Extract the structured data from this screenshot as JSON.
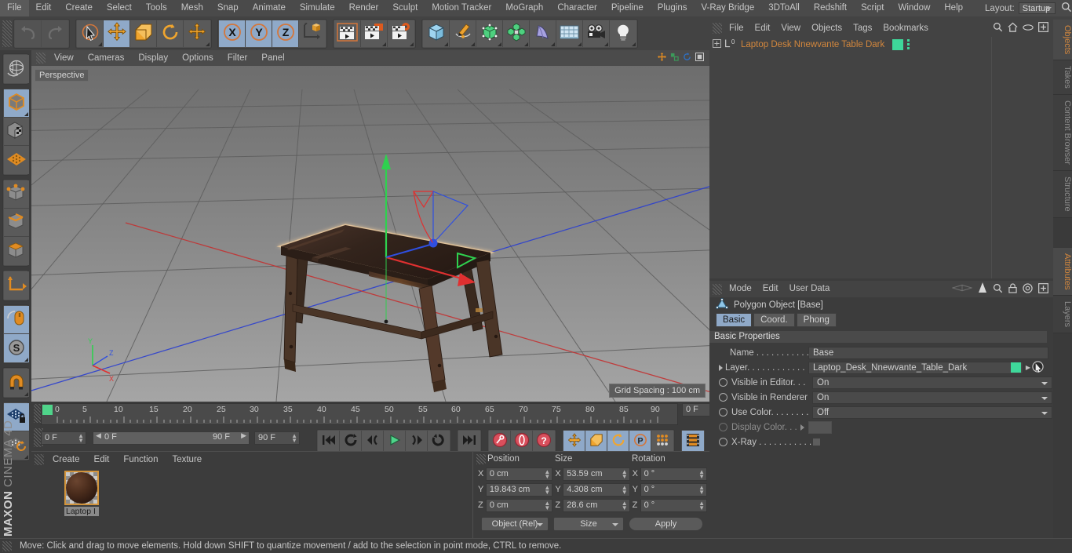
{
  "app": {
    "title": "MAXON CINEMA 4D",
    "brand_bold": "MAXON",
    "brand_light": "CINEMA 4D"
  },
  "menubar": {
    "items": [
      "File",
      "Edit",
      "Create",
      "Select",
      "Tools",
      "Mesh",
      "Snap",
      "Animate",
      "Simulate",
      "Render",
      "Sculpt",
      "Motion Tracker",
      "MoGraph",
      "Character",
      "Pipeline",
      "Plugins",
      "V-Ray Bridge",
      "3DToAll",
      "Redshift",
      "Script",
      "Window",
      "Help"
    ],
    "layout_label": "Layout:",
    "layout_value": "Startup",
    "search_icon": "magnifier-icon"
  },
  "toolbar": {
    "groups": [
      {
        "name": "undo-redo",
        "buttons": [
          {
            "icon": "undo-icon",
            "label": "Undo",
            "active": false,
            "disabled": true
          },
          {
            "icon": "redo-icon",
            "label": "Redo",
            "active": false,
            "disabled": true
          }
        ]
      },
      {
        "name": "transform-tools",
        "buttons": [
          {
            "icon": "select-cursor-icon",
            "label": "Live Selection",
            "active": false,
            "disabled": false
          },
          {
            "icon": "move-icon",
            "label": "Move",
            "active": true,
            "disabled": false
          },
          {
            "icon": "scale-icon",
            "label": "Scale",
            "active": false,
            "disabled": false
          },
          {
            "icon": "rotate-icon",
            "label": "Rotate",
            "active": false,
            "disabled": false
          },
          {
            "icon": "move-alt-icon",
            "label": "Move Tool Variant",
            "active": false,
            "disabled": false
          }
        ]
      },
      {
        "name": "axis-locks",
        "buttons": [
          {
            "icon": "x-axis-icon",
            "label": "X",
            "active": true,
            "disabled": false
          },
          {
            "icon": "y-axis-icon",
            "label": "Y",
            "active": true,
            "disabled": false
          },
          {
            "icon": "z-axis-icon",
            "label": "Z",
            "active": true,
            "disabled": false
          },
          {
            "icon": "world-object-coord-icon",
            "label": "World/Object",
            "active": false,
            "disabled": false
          }
        ]
      },
      {
        "name": "render-tools",
        "buttons": [
          {
            "icon": "render-view-icon",
            "label": "Render View",
            "active": false,
            "disabled": false
          },
          {
            "icon": "render-region-icon",
            "label": "Render to Picture Viewer",
            "active": false,
            "disabled": false
          },
          {
            "icon": "render-settings-icon",
            "label": "Edit Render Settings",
            "active": false,
            "disabled": false
          }
        ]
      },
      {
        "name": "create-objects",
        "buttons": [
          {
            "icon": "cube-icon",
            "label": "Add Cube Object",
            "active": false,
            "disabled": false
          },
          {
            "icon": "pen-spline-icon",
            "label": "Add Spline",
            "active": false,
            "disabled": false
          },
          {
            "icon": "nurbs-icon",
            "label": "Add HyperNURBS",
            "active": false,
            "disabled": false
          },
          {
            "icon": "array-icon",
            "label": "Add Array Object",
            "active": false,
            "disabled": false
          },
          {
            "icon": "bend-deformer-icon",
            "label": "Add Bend Object",
            "active": false,
            "disabled": false
          },
          {
            "icon": "floor-environment-icon",
            "label": "Add Floor Object",
            "active": false,
            "disabled": false
          },
          {
            "icon": "camera-icon",
            "label": "Add Camera",
            "active": false,
            "disabled": false
          },
          {
            "icon": "light-icon",
            "label": "Add Light",
            "active": false,
            "disabled": false
          }
        ]
      }
    ]
  },
  "left_palette": {
    "groups": [
      {
        "name": "modeling-axis",
        "buttons": [
          {
            "icon": "rotate-world-icon",
            "label": "Make Editable / Axis",
            "active": false
          }
        ]
      },
      {
        "name": "mode-objects",
        "buttons": [
          {
            "icon": "model-mode-icon",
            "label": "Model Mode",
            "active": true
          },
          {
            "icon": "texture-mode-icon",
            "label": "Texture Mode",
            "active": false
          },
          {
            "icon": "workplane-mode-icon",
            "label": "Workplane Mode",
            "active": false
          }
        ]
      },
      {
        "name": "component-modes",
        "buttons": [
          {
            "icon": "points-mode-icon",
            "label": "Points Mode",
            "active": false
          },
          {
            "icon": "edges-mode-icon",
            "label": "Edges Mode",
            "active": false
          },
          {
            "icon": "polygons-mode-icon",
            "label": "Polygons Mode",
            "active": false
          }
        ]
      },
      {
        "name": "axis-tools",
        "buttons": [
          {
            "icon": "enable-axis-icon",
            "label": "Enable Axis Modification",
            "active": false
          }
        ]
      },
      {
        "name": "snap-tools",
        "buttons": [
          {
            "icon": "mouse-viewport-icon",
            "label": "Viewport Solo",
            "active": true
          },
          {
            "icon": "snap-s-icon",
            "label": "Enable Snap",
            "active": true
          }
        ]
      },
      {
        "name": "magnet",
        "buttons": [
          {
            "icon": "magnet-icon",
            "label": "Enable Quantizing",
            "active": false
          }
        ]
      },
      {
        "name": "workplane",
        "buttons": [
          {
            "icon": "lock-workplane-icon",
            "label": "Lock Workplane",
            "active": true
          },
          {
            "icon": "planar-workplane-icon",
            "label": "Planar Workplane",
            "active": false
          }
        ]
      }
    ]
  },
  "viewport": {
    "menu": [
      "View",
      "Cameras",
      "Display",
      "Options",
      "Filter",
      "Panel"
    ],
    "label": "Perspective",
    "grid_spacing": "Grid Spacing : 100 cm",
    "axis_gizmo": {
      "x": "X",
      "y": "Y",
      "z": "Z"
    },
    "icons": [
      "viewport-move-icon",
      "viewport-scale-icon",
      "viewport-rotate-icon",
      "viewport-maximize-icon"
    ],
    "colors": {
      "x_axis": "#e03030",
      "y_axis": "#2fd14f",
      "z_axis": "#2f4fe0",
      "highlight": "#e8c79b"
    }
  },
  "timeline": {
    "ticks": [
      "0",
      "5",
      "10",
      "15",
      "20",
      "25",
      "30",
      "35",
      "40",
      "45",
      "50",
      "55",
      "60",
      "65",
      "70",
      "75",
      "80",
      "85",
      "90"
    ],
    "current_frame_right": "0 F",
    "current_frame_field": "0 F",
    "range_start": "0 F",
    "range_end": "90 F",
    "end_frame_field": "90 F",
    "transport": [
      {
        "icon": "go-to-start-icon",
        "label": "Go to Start",
        "active": false
      },
      {
        "icon": "play-backwards-loop-icon",
        "label": "Play Backwards",
        "active": false
      },
      {
        "icon": "step-back-icon",
        "label": "Previous Frame",
        "active": false
      },
      {
        "icon": "play-icon",
        "label": "Play Forwards",
        "active": false
      },
      {
        "icon": "step-forward-icon",
        "label": "Next Frame",
        "active": false
      },
      {
        "icon": "loop-icon",
        "label": "Play Mode Loop",
        "active": false
      },
      {
        "icon": "go-to-end-icon",
        "label": "Go to End",
        "active": false
      }
    ],
    "keyframe_buttons": [
      {
        "icon": "record-key-icon",
        "label": "Record Active Objects",
        "active": false
      },
      {
        "icon": "autokey-icon",
        "label": "Autokeying",
        "active": false
      },
      {
        "icon": "keyframe-selection-icon",
        "label": "Keyframe Selection",
        "active": false
      }
    ],
    "key_channels": [
      {
        "icon": "key-position-icon",
        "label": "Position",
        "active": true
      },
      {
        "icon": "key-scale-icon",
        "label": "Scale",
        "active": true
      },
      {
        "icon": "key-rotation-icon",
        "label": "Rotation",
        "active": true
      },
      {
        "icon": "key-param-icon",
        "label": "Parameter (P)",
        "active": true
      },
      {
        "icon": "key-pla-icon",
        "label": "Point Level Animation",
        "active": false
      }
    ],
    "timeline_toggle": {
      "icon": "timeline-filmstrip-icon",
      "label": "Animation Layers",
      "active": true
    }
  },
  "material_manager": {
    "menu": [
      "Create",
      "Edit",
      "Function",
      "Texture"
    ],
    "materials": [
      {
        "name": "Laptop I",
        "swatch": "material-sphere-icon"
      }
    ]
  },
  "coordinates": {
    "headers": [
      "Position",
      "Size",
      "Rotation"
    ],
    "rows": [
      {
        "axis": "X",
        "position": "0 cm",
        "size": "53.59 cm",
        "rotation": "0 °"
      },
      {
        "axis": "Y",
        "position": "19.843 cm",
        "size": "4.308 cm",
        "rotation": "0 °"
      },
      {
        "axis": "Z",
        "position": "0 cm",
        "size": "28.6 cm",
        "rotation": "0 °"
      }
    ],
    "mode_dropdown": "Object (Rel)",
    "size_dropdown": "Size",
    "apply_label": "Apply"
  },
  "object_manager": {
    "title": "Objects",
    "menu": [
      "File",
      "Edit",
      "View",
      "Objects",
      "Tags",
      "Bookmarks"
    ],
    "icons": [
      "search-icon",
      "home-icon",
      "eye-icon",
      "plus-box-icon"
    ],
    "objects": [
      {
        "name": "Laptop Desk Nnewvante Table Dark",
        "layer_color": "#3ed89a",
        "level": "0",
        "expandable": true
      }
    ]
  },
  "attribute_manager": {
    "title": "Attributes",
    "menu": [
      "Mode",
      "Edit",
      "User Data"
    ],
    "icons": [
      "fold-icon",
      "cursor-arrow-icon",
      "search-icon",
      "lock-icon",
      "target-icon",
      "plus-box-icon"
    ],
    "object_type": "Polygon Object [Base]",
    "tabs": [
      {
        "label": "Basic",
        "active": true
      },
      {
        "label": "Coord.",
        "active": false
      },
      {
        "label": "Phong",
        "active": false
      }
    ],
    "section_title": "Basic Properties",
    "properties": [
      {
        "label": "Name . . . . . . . . . . .",
        "type": "text",
        "value": "Base"
      },
      {
        "label": "Layer. . . . . . . . . . . .",
        "type": "layer",
        "value": "Laptop_Desk_Nnewvante_Table_Dark",
        "color": "#3ed89a"
      },
      {
        "label": "Visible in Editor. . .",
        "type": "dropdown",
        "value": "On"
      },
      {
        "label": "Visible in Renderer",
        "type": "dropdown",
        "value": "On"
      },
      {
        "label": "Use Color. . . . . . . .",
        "type": "dropdown",
        "value": "Off"
      },
      {
        "label": "Display Color. . .",
        "type": "color",
        "value": "",
        "disabled": true
      },
      {
        "label": "X-Ray . . . . . . . . . . .",
        "type": "checkbox",
        "value": ""
      }
    ]
  },
  "vertical_tabs_top": [
    {
      "label": "Objects",
      "active": true
    },
    {
      "label": "Takes",
      "active": false
    },
    {
      "label": "Content Browser",
      "active": false
    },
    {
      "label": "Structure",
      "active": false
    }
  ],
  "vertical_tabs_bottom": [
    {
      "label": "Attributes",
      "active": true
    },
    {
      "label": "Layers",
      "active": false
    }
  ],
  "statusbar": {
    "message": "Move: Click and drag to move elements. Hold down SHIFT to quantize movement / add to the selection in point mode, CTRL to remove."
  }
}
